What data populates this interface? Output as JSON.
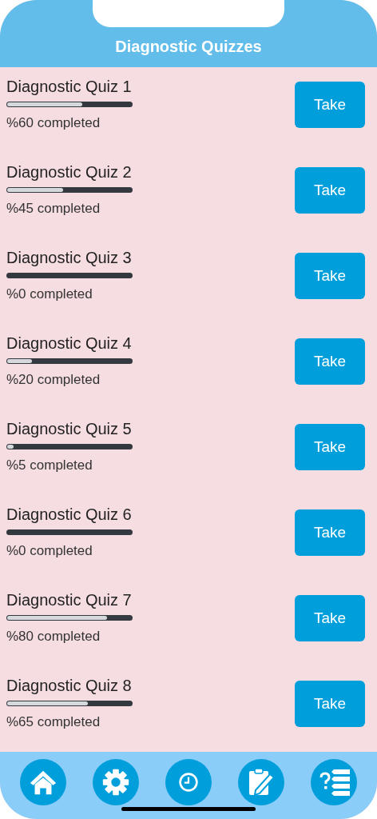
{
  "header": {
    "title": "Diagnostic Quizzes"
  },
  "quizzes": [
    {
      "name": "Diagnostic Quiz 1",
      "level": 0.6,
      "progress": "%60 completed",
      "button": "Take"
    },
    {
      "name": "Diagnostic Quiz 2",
      "level": 0.45,
      "progress": "%45 completed",
      "button": "Take"
    },
    {
      "name": "Diagnostic Quiz 3",
      "progress": "%0 completed",
      "button": "Take"
    },
    {
      "name": "Diagnostic Quiz 4",
      "level": 0.2,
      "progress": "%20 completed",
      "button": "Take"
    },
    {
      "name": "Diagnostic Quiz 5",
      "level": 0.05,
      "progress": "%5 completed",
      "button": "Take"
    },
    {
      "name": "Diagnostic Quiz 6",
      "progress": "%0 completed",
      "button": "Take"
    },
    {
      "name": "Diagnostic Quiz 7",
      "level": 0.8,
      "progress": "%80 completed",
      "button": "Take"
    },
    {
      "name": "Diagnostic Quiz 8",
      "level": 0.65,
      "progress": "%65 completed",
      "button": "Take"
    }
  ],
  "tab_bar": [
    {
      "kind": "home"
    },
    {
      "kind": "settings"
    },
    {
      "kind": "clock"
    },
    {
      "kind": "notes"
    },
    {
      "kind": "quiz"
    }
  ]
}
